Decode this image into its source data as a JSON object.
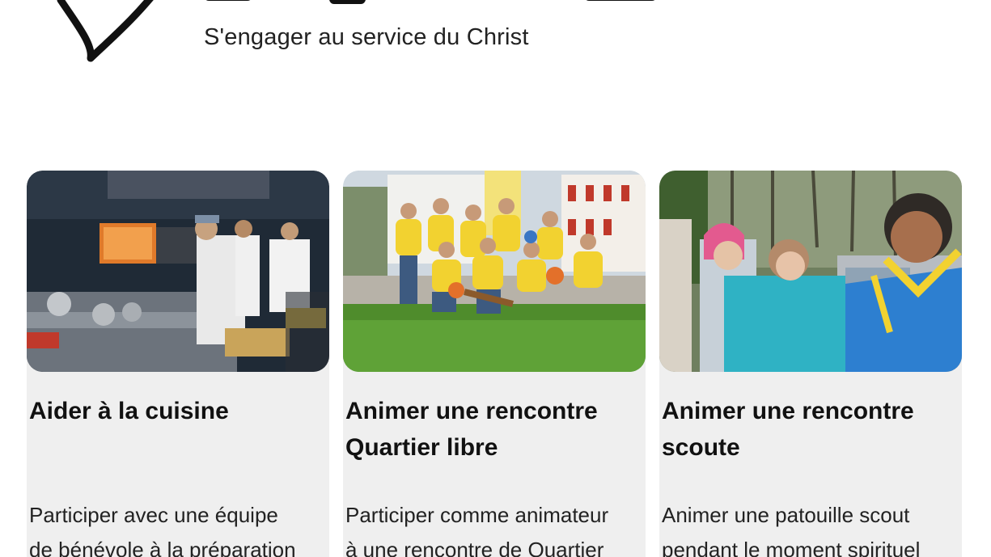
{
  "header": {
    "tagline": "S'engager au service du Christ"
  },
  "cards": [
    {
      "title": "Aider à la cuisine",
      "description_lines": [
        "Participer avec une équipe",
        "de bénévole à la préparation"
      ],
      "image": "kitchen-volunteers-photo"
    },
    {
      "title_lines": [
        "Animer une rencontre",
        "Quartier libre"
      ],
      "description_lines": [
        "Participer comme animateur",
        "à une rencontre de Quartier"
      ],
      "image": "quartier-libre-group-photo"
    },
    {
      "title_lines": [
        "Animer une rencontre",
        "scoute"
      ],
      "description_lines": [
        "Animer une patouille scout",
        "pendant le moment spirituel"
      ],
      "image": "scouts-photo"
    }
  ],
  "colors": {
    "card_background": "#efefef",
    "text": "#111111",
    "page_background": "#ffffff"
  }
}
